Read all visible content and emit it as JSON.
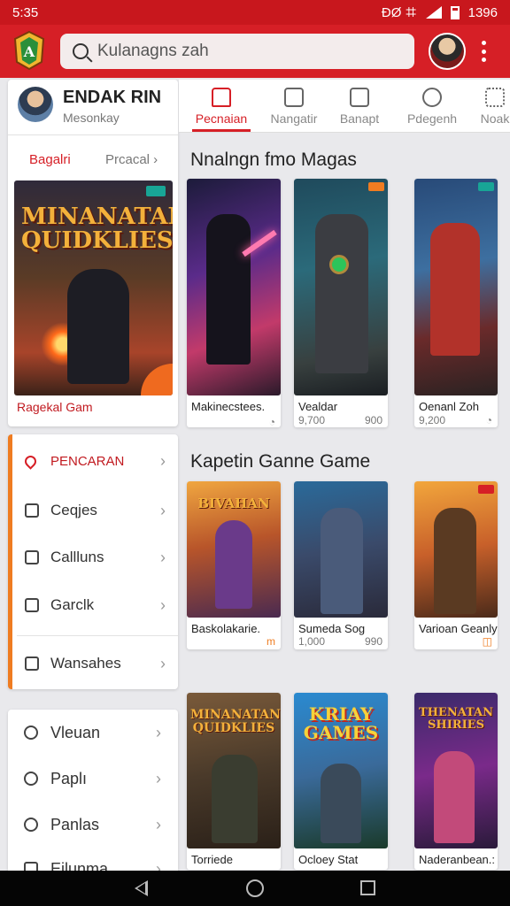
{
  "status_bar": {
    "time": "5:35",
    "icons_text": "ÐØ ꖛ",
    "battery_text": "1396"
  },
  "app_bar": {
    "search_placeholder": "Kulanagns zah",
    "brand_color": "#d61f26"
  },
  "profile": {
    "name": "ENDAK RIN",
    "subtitle": "Mesonkay",
    "link_primary": "Bagalri",
    "link_secondary": "Prcacal ›",
    "featured_caption": "Ragekal Gam",
    "featured_cover_title": "MINANATAN QUIDKLIES"
  },
  "menu_primary": [
    {
      "label": "PENCARAN",
      "icon": "heart-icon"
    },
    {
      "label": "Ceqjes",
      "icon": "pen-icon"
    },
    {
      "label": "Callluns",
      "icon": "square-dot-icon"
    },
    {
      "label": "Garclk",
      "icon": "refresh-icon"
    },
    {
      "label": "Wansahes",
      "icon": "checkbox-icon"
    }
  ],
  "menu_secondary": [
    {
      "label": "Vleuan",
      "icon": "chat-icon"
    },
    {
      "label": "Paplı",
      "icon": "shield-icon"
    },
    {
      "label": "Panlas",
      "icon": "shield-icon"
    },
    {
      "label": "Eilunma",
      "icon": "list-icon"
    }
  ],
  "tabs": [
    {
      "label": "Pecnaian",
      "icon": "home-icon",
      "active": true
    },
    {
      "label": "Nangatir",
      "icon": "refresh-icon",
      "active": false
    },
    {
      "label": "Banapt",
      "icon": "document-icon",
      "active": false
    },
    {
      "label": "Pdegenh",
      "icon": "compass-icon",
      "active": false
    },
    {
      "label": "Noak",
      "icon": "grid-icon",
      "active": false
    }
  ],
  "section1": {
    "title": "Nnalngn fmo Magas",
    "games": [
      {
        "name": "Makinecstees.",
        "meta": "",
        "meta2": "◔"
      },
      {
        "name": "Vealdar",
        "meta": "9,700",
        "meta2": "900"
      },
      {
        "name": "Oenanl Zoh",
        "meta": "9,200",
        "meta2": "◔"
      }
    ]
  },
  "section2": {
    "title": "Kapetin Ganne Game",
    "games": [
      {
        "name": "Baskolakarie.",
        "meta": "",
        "meta2": "m",
        "art_title": "BIVAHAN"
      },
      {
        "name": "Sumeda Sog",
        "meta": "1,000",
        "meta2": "990",
        "art_title": ""
      },
      {
        "name": "Varioan Geanly",
        "meta": "",
        "meta2": "◫",
        "art_title": ""
      }
    ]
  },
  "section3": {
    "games": [
      {
        "name": "Torriede",
        "meta2": "",
        "art_title": "MINANATAN QUIDKLIES"
      },
      {
        "name": "Ocloey Stat",
        "meta2": "",
        "art_title": "KRIAY GAMES"
      },
      {
        "name": "Naderanbean.:",
        "meta2": "",
        "art_title": "THENATAN SHIRIES"
      }
    ]
  }
}
